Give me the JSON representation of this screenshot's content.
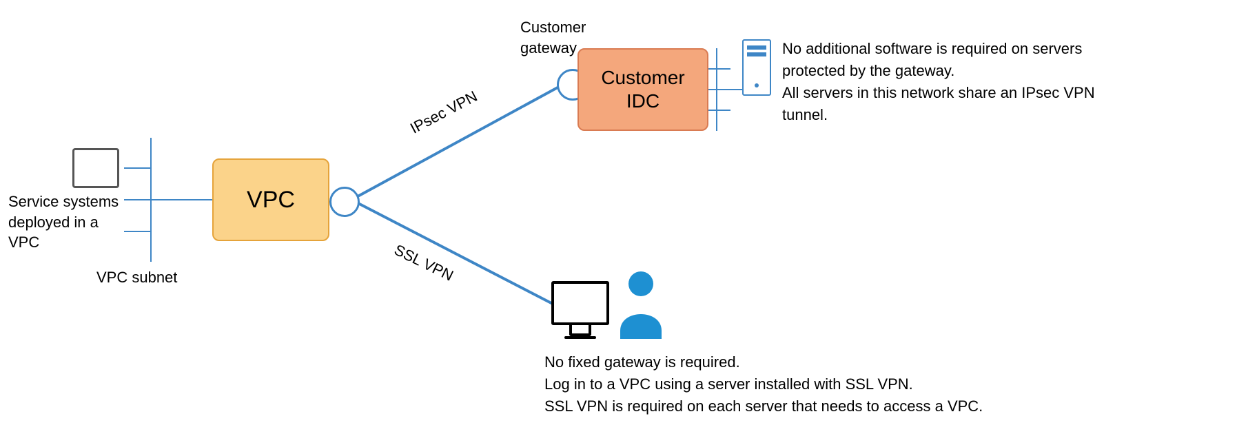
{
  "left": {
    "service_label_line1": "Service systems",
    "service_label_line2": "deployed in a",
    "service_label_line3": "VPC",
    "subnet_label": "VPC subnet"
  },
  "vpc": {
    "label": "VPC"
  },
  "links": {
    "ipsec_label": "IPsec VPN",
    "ssl_label": "SSL VPN"
  },
  "customer_gateway": {
    "label_line1": "Customer",
    "label_line2": "gateway"
  },
  "idc": {
    "label_line1": "Customer",
    "label_line2": "IDC"
  },
  "idc_desc": {
    "line1": "No additional software is required on servers",
    "line2": "protected by the gateway.",
    "line3": "All servers in this network share an IPsec VPN",
    "line4": "tunnel."
  },
  "ssl_desc": {
    "line1": "No fixed gateway is required.",
    "line2": "Log in to a VPC using a server installed with SSL VPN.",
    "line3": "SSL VPN is required on each server that needs to access a VPC."
  }
}
